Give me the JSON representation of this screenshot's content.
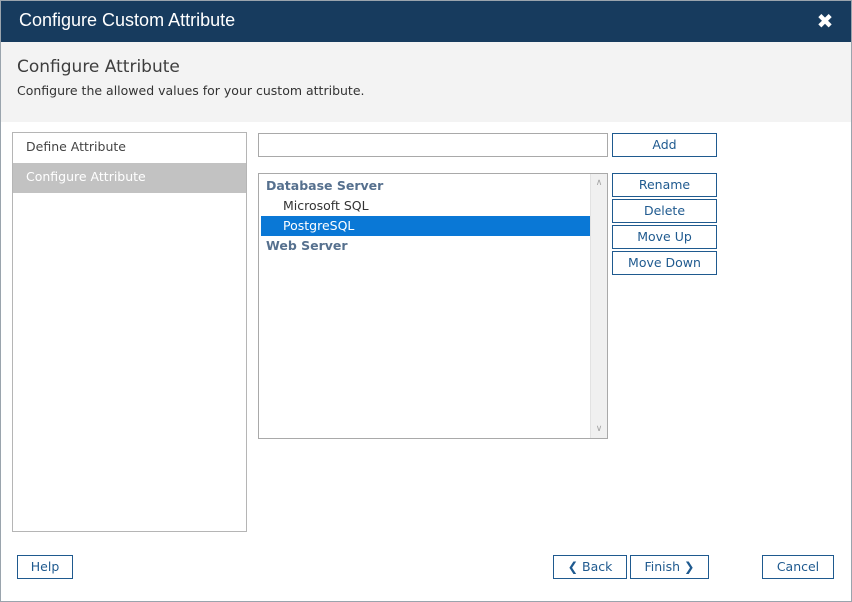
{
  "window": {
    "title": "Configure Custom Attribute",
    "close_glyph": "✖"
  },
  "header": {
    "title": "Configure Attribute",
    "subtitle": "Configure the allowed values for your custom attribute."
  },
  "steps": [
    {
      "label": "Define Attribute",
      "active": false
    },
    {
      "label": "Configure Attribute",
      "active": true
    }
  ],
  "new_value": {
    "value": "",
    "placeholder": ""
  },
  "buttons": {
    "add": "Add",
    "rename": "Rename",
    "delete": "Delete",
    "move_up": "Move Up",
    "move_down": "Move Down"
  },
  "values_list": [
    {
      "label": "Database Server",
      "kind": "group",
      "selected": false
    },
    {
      "label": "Microsoft SQL",
      "kind": "item",
      "selected": false
    },
    {
      "label": "PostgreSQL",
      "kind": "item",
      "selected": true
    },
    {
      "label": "Web Server",
      "kind": "group",
      "selected": false
    }
  ],
  "scrollbar": {
    "up_glyph": "∧",
    "down_glyph": "∨"
  },
  "footer": {
    "help": "Help",
    "back": "Back",
    "back_glyph": "❮",
    "finish": "Finish",
    "finish_glyph": "❯",
    "cancel": "Cancel"
  },
  "colors": {
    "titlebar": "#173b5e",
    "accent": "#1f5a8f",
    "selection": "#0a78d6",
    "active_step": "#c2c2c2"
  }
}
